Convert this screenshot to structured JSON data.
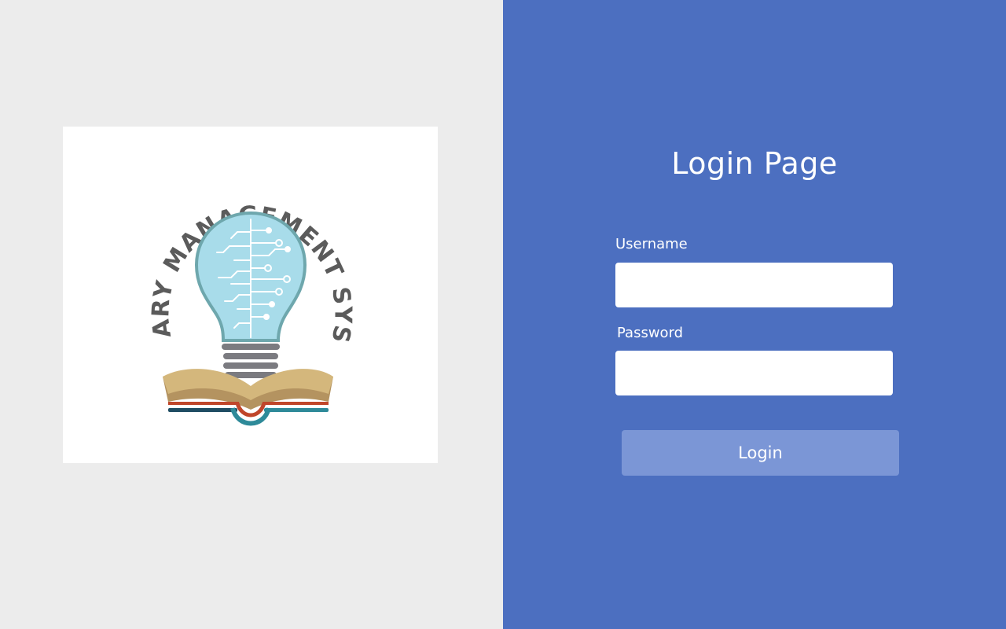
{
  "logo": {
    "text": "LIBRARY MANAGEMENT SYSTEM",
    "colors": {
      "text": "#5b5b5b",
      "bulb_fill": "#a8dcea",
      "bulb_outline": "#6ea7ad",
      "circuit": "#ffffff",
      "bulb_base": "#7b7b80",
      "book_page": "#d4b77c",
      "book_page_dark": "#b49360",
      "book_red": "#c0462a",
      "book_teal": "#2e8a99",
      "book_navy": "#1f4d63"
    }
  },
  "login": {
    "title": "Login Page",
    "username_label": "Username",
    "username_value": "",
    "password_label": "Password",
    "password_value": "",
    "submit_label": "Login"
  },
  "colors": {
    "left_background": "#ececec",
    "right_background": "#4c6fc0",
    "button_background": "#7b96d6",
    "text": "#ffffff"
  }
}
